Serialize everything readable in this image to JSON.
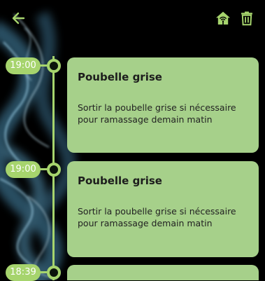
{
  "appbar": {
    "back_icon": "arrow-left-icon",
    "home_icon": "home-wifi-icon",
    "delete_icon": "trash-icon",
    "accent_color": "#a6d46d"
  },
  "timeline": {
    "line_color": "#a6d46d",
    "card_color": "#a6d08a",
    "events": [
      {
        "time": "19:00",
        "title": "Poubelle grise",
        "description": "Sortir la poubelle grise si nécessaire pour ramassage demain matin"
      },
      {
        "time": "19:00",
        "title": "Poubelle grise",
        "description": "Sortir la poubelle grise si nécessaire pour ramassage demain matin"
      },
      {
        "time": "18:39",
        "title": "",
        "description": ""
      }
    ]
  }
}
